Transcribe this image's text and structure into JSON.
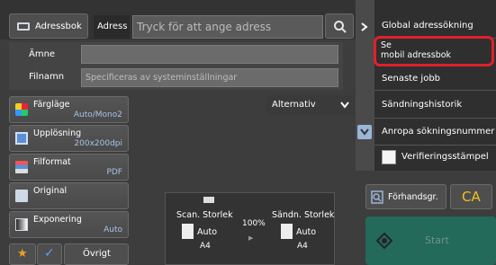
{
  "header": {
    "addressbook_label": "Adressbok",
    "address_label": "Adress",
    "search_placeholder": "Tryck för att ange adress"
  },
  "fields": {
    "subject_label": "Ämne",
    "subject_value": "",
    "filename_label": "Filnamn",
    "filename_placeholder": "Specificeras av systeminställningar"
  },
  "alternativ_label": "Alternativ",
  "settings": [
    {
      "label": "Färgläge",
      "value": "Auto/Mono2"
    },
    {
      "label": "Upplösning",
      "value": "200x200dpi"
    },
    {
      "label": "Filformat",
      "value": "PDF"
    },
    {
      "label": "Original",
      "value": ""
    },
    {
      "label": "Exponering",
      "value": "Auto"
    }
  ],
  "bottom": {
    "ovrigt_label": "Övrigt"
  },
  "scan_panel": {
    "scan_size_label": "Scan. Storlek",
    "send_size_label": "Sändn. Storlek",
    "ratio": "100%",
    "scan_auto": "Auto",
    "send_auto": "Auto",
    "scan_paper": "A4",
    "send_paper": "A4"
  },
  "menu": {
    "items": [
      "Global adressökning",
      "Se\nmobil adressbok",
      "Senaste jobb",
      "Sändningshistorik",
      "Anropa sökningsnummer",
      "Verifieringsstämpel"
    ]
  },
  "actions": {
    "preview_label": "Förhandsgr.",
    "ca_label": "CA",
    "start_label": "Start"
  },
  "colors": {
    "accent_blue": "#1b63c6",
    "highlight_red": "#e0202a",
    "start_green": "#0e8f75",
    "ca_yellow": "#f0c020"
  }
}
